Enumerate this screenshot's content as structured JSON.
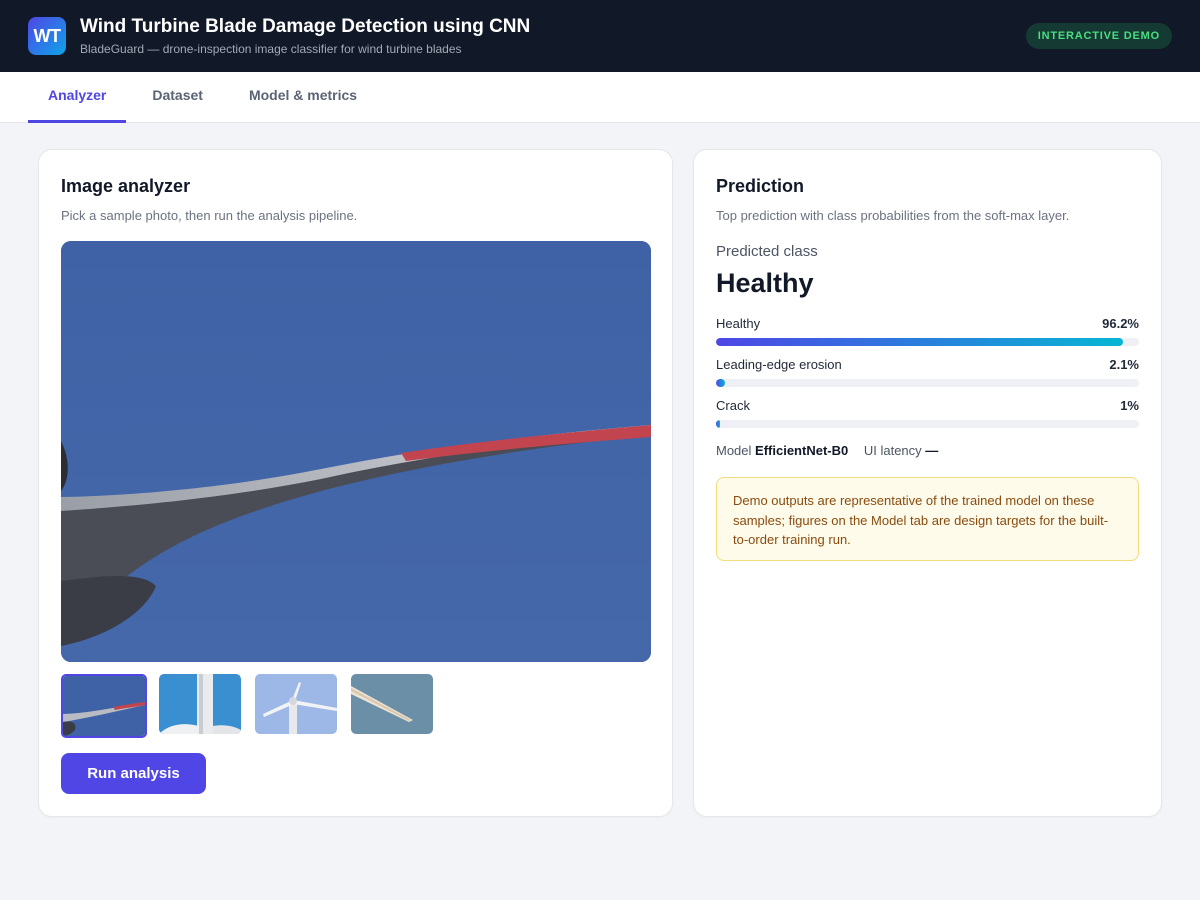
{
  "header": {
    "logo_text": "WT",
    "title": "Wind Turbine Blade Damage Detection using CNN",
    "subtitle": "BladeGuard — drone-inspection image classifier for wind turbine blades",
    "badge": "INTERACTIVE DEMO"
  },
  "tabs": [
    {
      "label": "Analyzer",
      "active": true
    },
    {
      "label": "Dataset",
      "active": false
    },
    {
      "label": "Model & metrics",
      "active": false
    }
  ],
  "analyzer": {
    "title": "Image analyzer",
    "description": "Pick a sample photo, then run the analysis pipeline.",
    "selected_thumbnail": 1,
    "thumbnail_count": 4,
    "run_button": "Run analysis"
  },
  "prediction": {
    "title": "Prediction",
    "description": "Top prediction with class probabilities from the soft-max layer.",
    "predicted_label": "Predicted class",
    "predicted_class": "Healthy",
    "probabilities": [
      {
        "label": "Healthy",
        "value_text": "96.2%",
        "value": 96.2
      },
      {
        "label": "Leading-edge erosion",
        "value_text": "2.1%",
        "value": 2.1
      },
      {
        "label": "Crack",
        "value_text": "1%",
        "value": 1
      }
    ],
    "model_label": "Model",
    "model_value": "EfficientNet-B0",
    "latency_label": "UI latency",
    "latency_value": "—",
    "notice": "Demo outputs are representative of the trained model on these samples; figures on the Model tab are design targets for the built-to-order training run."
  },
  "colors": {
    "accent": "#4f46e5",
    "header_bg": "#111827",
    "badge_text": "#4ade80",
    "notice_bg": "#fefbea"
  }
}
